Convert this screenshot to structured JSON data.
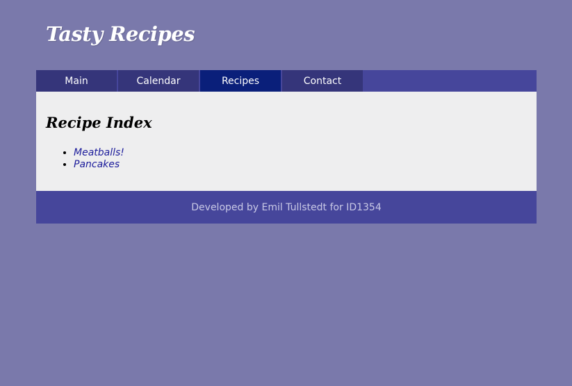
{
  "header": {
    "title": "Tasty Recipes"
  },
  "nav": {
    "items": [
      {
        "label": "Main"
      },
      {
        "label": "Calendar"
      },
      {
        "label": "Recipes"
      },
      {
        "label": "Contact"
      }
    ],
    "active": "Recipes"
  },
  "main": {
    "heading": "Recipe Index",
    "recipes": [
      {
        "label": "Meatballs!"
      },
      {
        "label": "Pancakes"
      }
    ]
  },
  "footer": {
    "text": "Developed by Emil Tullstedt for ID1354"
  },
  "colors": {
    "background": "#7a79ab",
    "nav_bar": "#46469b",
    "nav_item": "#35357a",
    "nav_active": "#0a1f7a",
    "content_bg": "#eeeeef",
    "link": "#1a1a9a"
  }
}
